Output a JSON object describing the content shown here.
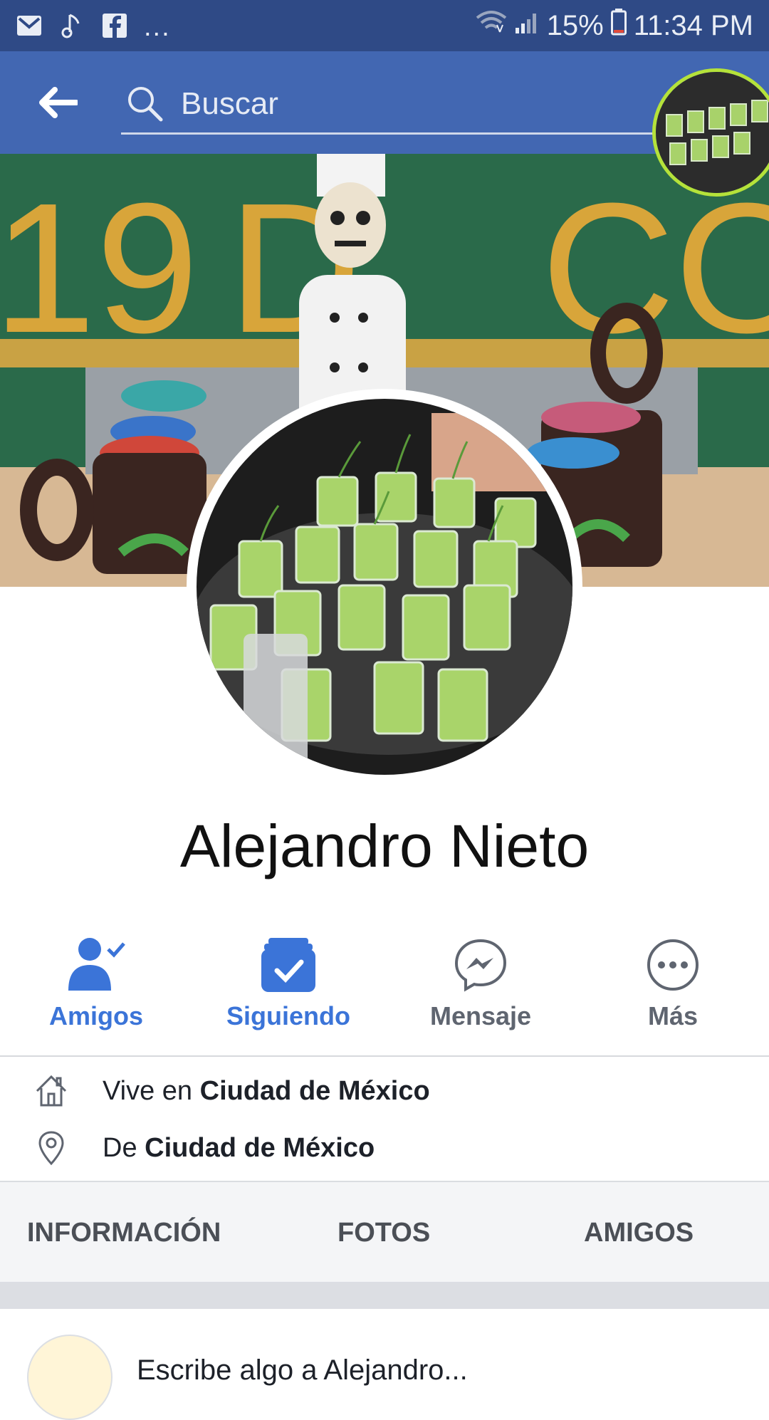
{
  "status_bar": {
    "icons": [
      "gmail-icon",
      "music-note-icon",
      "facebook-icon"
    ],
    "more": "...",
    "battery": "15%",
    "time": "11:34 PM"
  },
  "app_bar": {
    "search_placeholder": "Buscar"
  },
  "profile": {
    "name": "Alejandro Nieto"
  },
  "actions": [
    {
      "label": "Amigos",
      "icon": "friends-check-icon"
    },
    {
      "label": "Siguiendo",
      "icon": "following-check-icon"
    },
    {
      "label": "Mensaje",
      "icon": "messenger-icon"
    },
    {
      "label": "Más",
      "icon": "more-dots-icon"
    }
  ],
  "info": {
    "lives_prefix": "Vive en",
    "lives_city": "Ciudad de México",
    "from_prefix": "De",
    "from_city": "Ciudad de México"
  },
  "tabs": [
    "INFORMACIÓN",
    "FOTOS",
    "AMIGOS"
  ],
  "post_preview": {
    "text": "Escribe algo a Alejandro..."
  },
  "colors": {
    "status_bar": "#2f4a86",
    "app_bar": "#4267b2",
    "accent_blue": "#3b74d8"
  }
}
